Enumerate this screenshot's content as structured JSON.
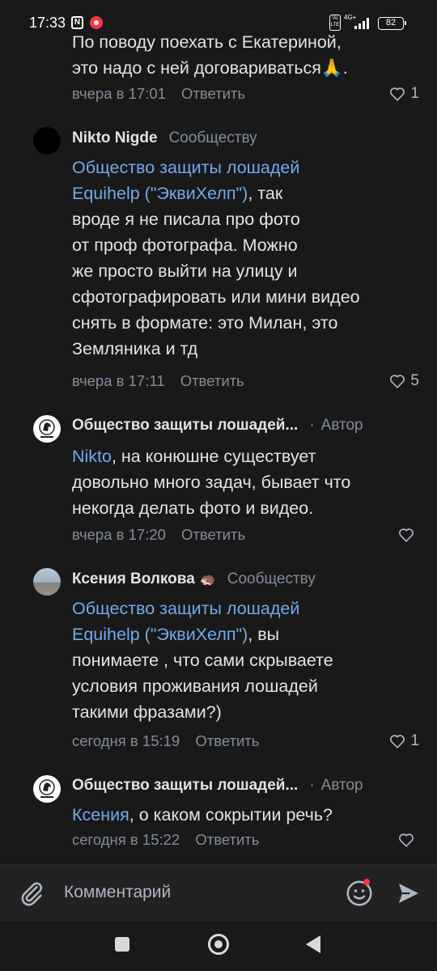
{
  "status_bar": {
    "time": "17:33",
    "nfc_glyph": "N",
    "volte": "Vo LTE",
    "network": "4G+",
    "battery": "82"
  },
  "comments": [
    {
      "text_lines": [
        "По поводу поехать с Екатериной,",
        "это надо с ней договариваться🙏."
      ],
      "time": "вчера в 17:01",
      "reply": "Ответить",
      "likes": "1"
    },
    {
      "author": "Nikto Nigde",
      "role": "Сообществу",
      "mention": "Общество защиты лошадей Equihelp (\"ЭквиХелп\")",
      "mention_lines": [
        "Общество защиты лошадей",
        "Equihelp (\"ЭквиХелп\")"
      ],
      "text_after_mention": ", так",
      "text_lines": [
        "вроде я не писала про фото",
        "от проф фотографа. Можно",
        "же просто выйти на улицу и",
        "сфотографировать или мини видео",
        "снять в формате: это Милан, это",
        "Земляника и тд"
      ],
      "time": "вчера в 17:11",
      "reply": "Ответить",
      "likes": "5"
    },
    {
      "author": "Общество защиты лошадей...",
      "role": "Автор",
      "mention": "Nikto",
      "text_after_mention": ", на конюшне существует",
      "text_lines": [
        "довольно много задач, бывает что",
        "некогда делать фото и видео."
      ],
      "time": "вчера в 17:20",
      "reply": "Ответить",
      "likes": ""
    },
    {
      "author": "Ксения Волкова",
      "author_emoji": "🦔",
      "role": "Сообществу",
      "mention": "Общество защиты лошадей Equihelp (\"ЭквиХелп\")",
      "mention_lines": [
        "Общество защиты лошадей",
        "Equihelp (\"ЭквиХелп\")"
      ],
      "text_after_mention": ", вы",
      "text_lines": [
        "понимаете , что сами скрываете",
        "условия проживания лошадей",
        "такими фразами?)"
      ],
      "time": "сегодня в 15:19",
      "reply": "Ответить",
      "likes": "1"
    },
    {
      "author": "Общество защиты лошадей...",
      "role": "Автор",
      "mention": "Ксения",
      "text_after_mention": ", о каком сокрытии речь?",
      "time": "сегодня в 15:22",
      "reply": "Ответить",
      "likes": ""
    }
  ],
  "composer": {
    "placeholder": "Комментарий"
  },
  "icons": {
    "attach": "paperclip-icon",
    "emoji": "smile-icon",
    "send": "send-icon",
    "like": "heart-icon"
  },
  "colors": {
    "background": "#191919",
    "link": "#71aaeb",
    "secondary": "#818c99",
    "text": "#e1e3e6",
    "notification_dot": "#ff3347"
  }
}
